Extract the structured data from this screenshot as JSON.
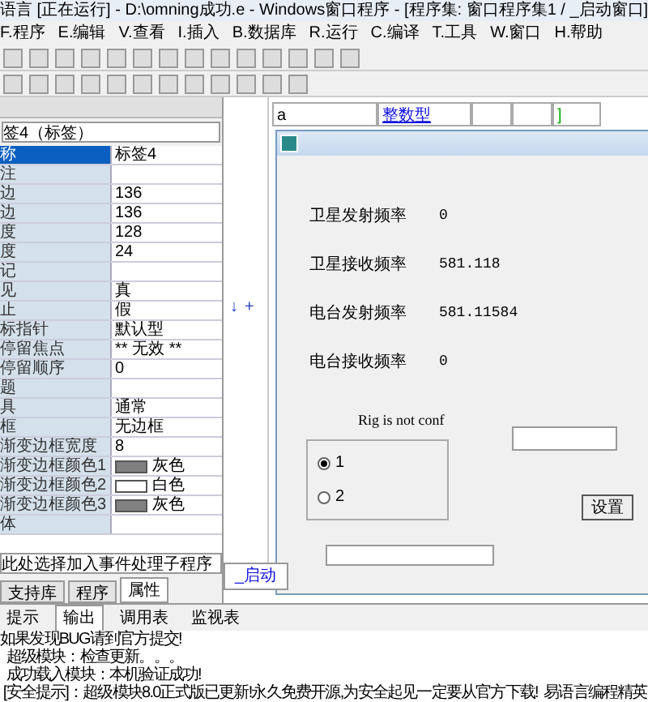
{
  "window": {
    "title": "语言 [正在运行] - D:\\omning成功.e - Windows窗口程序 - [程序集: 窗口程序集1 / _启动窗口]"
  },
  "menu": [
    "F.程序",
    "E.编辑",
    "V.查看",
    "I.插入",
    "B.数据库",
    "R.运行",
    "C.编译",
    "T.工具",
    "W.窗口",
    "H.帮助"
  ],
  "properties": {
    "object": "签4（标签）",
    "rows": [
      {
        "name": "称",
        "value": "标签4",
        "selected": true
      },
      {
        "name": "注",
        "value": "",
        "selected": false
      },
      {
        "name": "边",
        "value": "136",
        "selected": false
      },
      {
        "name": "边",
        "value": "136",
        "selected": false
      },
      {
        "name": "度",
        "value": "128",
        "selected": false
      },
      {
        "name": "度",
        "value": "24",
        "selected": false
      },
      {
        "name": "记",
        "value": "",
        "selected": false
      },
      {
        "name": "见",
        "value": "真",
        "selected": false
      },
      {
        "name": "止",
        "value": "假",
        "selected": false
      },
      {
        "name": "标指针",
        "value": "默认型",
        "selected": false
      },
      {
        "name": "停留焦点",
        "value": "** 无效 **",
        "selected": false
      },
      {
        "name": "停留顺序",
        "value": "0",
        "selected": false
      },
      {
        "name": "题",
        "value": "",
        "selected": false
      },
      {
        "name": "具",
        "value": "通常",
        "selected": false
      },
      {
        "name": "框",
        "value": "无边框",
        "selected": false
      },
      {
        "name": "渐变边框宽度",
        "value": "8",
        "selected": false
      },
      {
        "name": "渐变边框颜色1",
        "value": "灰色",
        "color": "#808080",
        "selected": false
      },
      {
        "name": "渐变边框颜色2",
        "value": "白色",
        "color": "#ffffff",
        "selected": false
      },
      {
        "name": "渐变边框颜色3",
        "value": "灰色",
        "color": "#808080",
        "selected": false
      },
      {
        "name": "体",
        "value": "",
        "selected": false
      }
    ],
    "event_select": "此处选择加入事件处理子程序"
  },
  "panel_tabs": [
    {
      "label": "支持库",
      "selected": false
    },
    {
      "label": "程序",
      "selected": false
    },
    {
      "label": "属性",
      "selected": true
    }
  ],
  "code_table": {
    "rows": [
      [
        "a",
        "整数型",
        "",
        "",
        "]"
      ]
    ]
  },
  "markers": [
    "↓",
    "+"
  ],
  "editor_tabs": [
    {
      "label": "_启动",
      "selected": true
    }
  ],
  "form": {
    "labels": [
      {
        "label": "卫星发射频率",
        "value": "0"
      },
      {
        "label": "卫星接收频率",
        "value": "581.118"
      },
      {
        "label": "电台发射频率",
        "value": "581.11584"
      },
      {
        "label": "电台接收频率",
        "value": "0"
      }
    ],
    "status": "Rig is not conf",
    "radios": [
      {
        "label": "1",
        "selected": true
      },
      {
        "label": "2",
        "selected": false
      }
    ],
    "button": "设置"
  },
  "output_tabs": [
    {
      "label": "提示",
      "selected": false
    },
    {
      "label": "输出",
      "selected": true
    },
    {
      "label": "调用表",
      "selected": false
    },
    {
      "label": "监视表",
      "selected": false
    }
  ],
  "output_lines": [
    "如果发现BUG请到官方提交!",
    "  超级模块：检查更新。。。",
    "  成功载入模块：本机验证成功!",
    " [安全提示]：超级模块8.0正式版已更新!永久免费开源,为安全起见一定要从官方下载!  易语言编程精英"
  ]
}
